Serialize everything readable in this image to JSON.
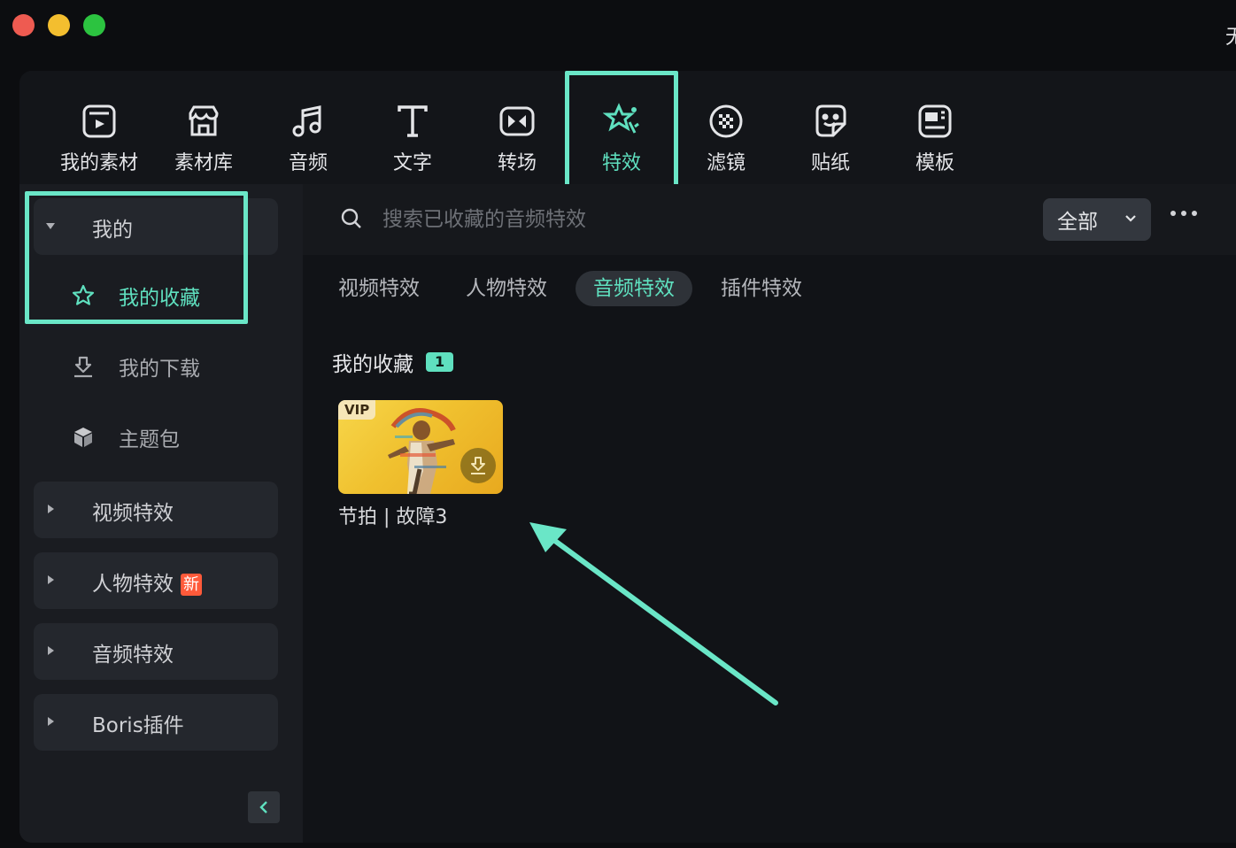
{
  "window": {
    "title_fragment": "无"
  },
  "toolbar": {
    "items": [
      {
        "label": "我的素材",
        "icon": "my-media-icon"
      },
      {
        "label": "素材库",
        "icon": "stock-library-icon"
      },
      {
        "label": "音频",
        "icon": "audio-note-icon"
      },
      {
        "label": "文字",
        "icon": "text-t-icon"
      },
      {
        "label": "转场",
        "icon": "transition-icon"
      },
      {
        "label": "特效",
        "icon": "effects-star-icon",
        "active": true
      },
      {
        "label": "滤镜",
        "icon": "filter-icon"
      },
      {
        "label": "贴纸",
        "icon": "sticker-icon"
      },
      {
        "label": "模板",
        "icon": "template-icon"
      }
    ]
  },
  "sidebar": {
    "mine": {
      "label": "我的"
    },
    "favorites": {
      "label": "我的收藏"
    },
    "downloads": {
      "label": "我的下载"
    },
    "theme_pack": {
      "label": "主题包"
    },
    "groups": [
      {
        "label": "视频特效"
      },
      {
        "label": "人物特效",
        "badge": "新"
      },
      {
        "label": "音频特效"
      },
      {
        "label": "Boris插件"
      }
    ]
  },
  "search": {
    "placeholder": "搜索已收藏的音频特效",
    "filter_value": "全部"
  },
  "tabs": [
    {
      "label": "视频特效"
    },
    {
      "label": "人物特效"
    },
    {
      "label": "音频特效",
      "active": true
    },
    {
      "label": "插件特效"
    }
  ],
  "section": {
    "title": "我的收藏",
    "count": "1"
  },
  "cards": [
    {
      "name": "节拍 | 故障3",
      "badge": "VIP"
    }
  ],
  "colors": {
    "accent": "#5fe0bf",
    "highlight": "#6ae6c7",
    "new_badge": "#ff5a3a"
  }
}
